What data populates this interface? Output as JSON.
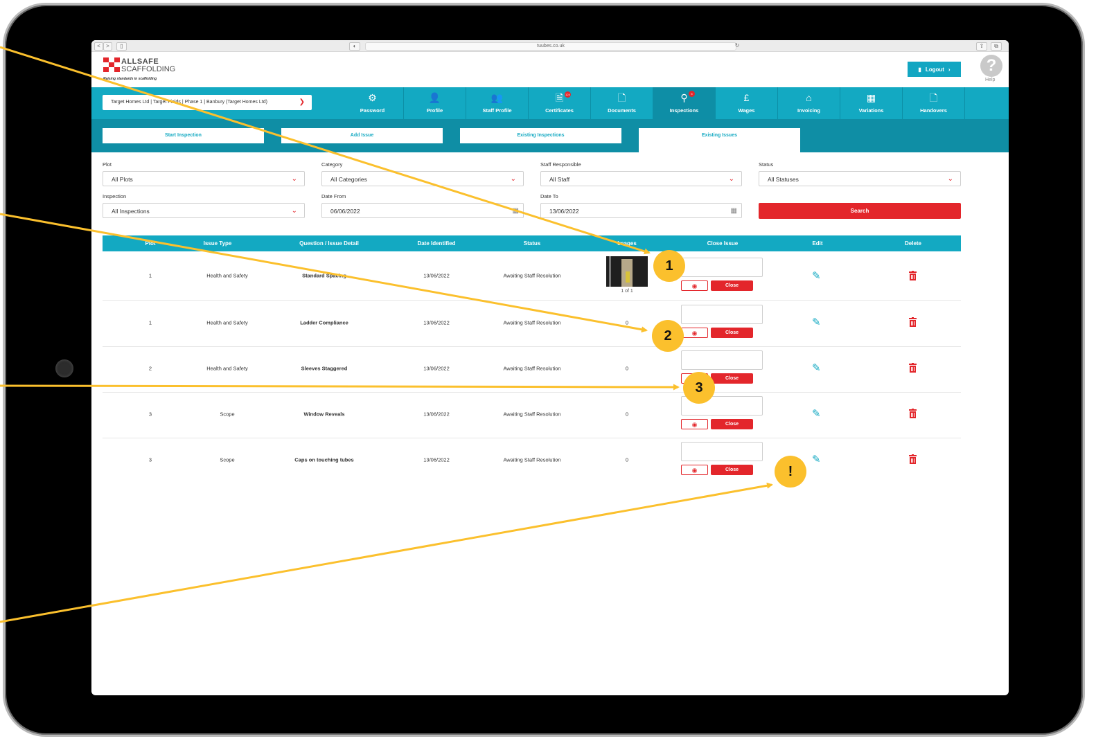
{
  "browser": {
    "url": "tuubes.co.uk",
    "back_label": "<",
    "forward_label": ">",
    "sidebar_label": "▯",
    "shield_label": "◐",
    "reload_label": "↻",
    "share_label": "⇪",
    "tabs_label": "⧉"
  },
  "header": {
    "logo_title": "ALLSAFE",
    "logo_subtitle": "SCAFFOLDING",
    "logo_tagline": "Raising standards in scaffolding",
    "logout_label": "Logout",
    "help_label": "Help"
  },
  "nav": {
    "site_selector": "Target Homes Ltd | Target Fields | Phase 1 | Banbury (Target Homes Ltd)",
    "items": [
      {
        "label": "Password",
        "icon": "⚙"
      },
      {
        "label": "Profile",
        "icon": "👤"
      },
      {
        "label": "Staff Profile",
        "icon": "👥"
      },
      {
        "label": "Certificates",
        "icon": "🗎",
        "badge": "124"
      },
      {
        "label": "Documents",
        "icon": "🗋"
      },
      {
        "label": "Inspections",
        "icon": "⚲",
        "badge": "5"
      },
      {
        "label": "Wages",
        "icon": "£"
      },
      {
        "label": "Invoicing",
        "icon": "⌂"
      },
      {
        "label": "Variations",
        "icon": "▦"
      },
      {
        "label": "Handovers",
        "icon": "🗋"
      }
    ]
  },
  "subtabs": [
    "Start Inspection",
    "Add Issue",
    "Existing Inspections",
    "Existing Issues"
  ],
  "filters": {
    "plot_label": "Plot",
    "plot_value": "All Plots",
    "category_label": "Category",
    "category_value": "All Categories",
    "staff_label": "Staff Responsible",
    "staff_value": "All Staff",
    "status_label": "Status",
    "status_value": "All Statuses",
    "inspection_label": "Inspection",
    "inspection_value": "All Inspections",
    "date_from_label": "Date From",
    "date_from_value": "06/06/2022",
    "date_to_label": "Date To",
    "date_to_value": "13/06/2022",
    "search_label": "Search"
  },
  "table": {
    "headers": [
      "Plot",
      "Issue Type",
      "Question / Issue Detail",
      "Date Identified",
      "Status",
      "Images",
      "Close Issue",
      "Edit",
      "Delete"
    ],
    "close_label": "Close",
    "image_count": "1 of 1",
    "rows": [
      {
        "plot": "1",
        "type": "Health and Safety",
        "detail": "Standard Spacing",
        "date": "13/06/2022",
        "status": "Awaiting Staff Resolution",
        "images": ""
      },
      {
        "plot": "1",
        "type": "Health and Safety",
        "detail": "Ladder Compliance",
        "date": "13/06/2022",
        "status": "Awaiting Staff Resolution",
        "images": "0"
      },
      {
        "plot": "2",
        "type": "Health and Safety",
        "detail": "Sleeves Staggered",
        "date": "13/06/2022",
        "status": "Awaiting Staff Resolution",
        "images": "0"
      },
      {
        "plot": "3",
        "type": "Scope",
        "detail": "Window Reveals",
        "date": "13/06/2022",
        "status": "Awaiting Staff Resolution",
        "images": "0"
      },
      {
        "plot": "3",
        "type": "Scope",
        "detail": "Caps on touching tubes",
        "date": "13/06/2022",
        "status": "Awaiting Staff Resolution",
        "images": "0"
      }
    ]
  },
  "callouts": [
    "1",
    "2",
    "3",
    "!"
  ],
  "colors": {
    "accent": "#13a9c2",
    "accent_dark": "#0f8ea5",
    "danger": "#e3262b",
    "callout": "#fbc02d"
  }
}
